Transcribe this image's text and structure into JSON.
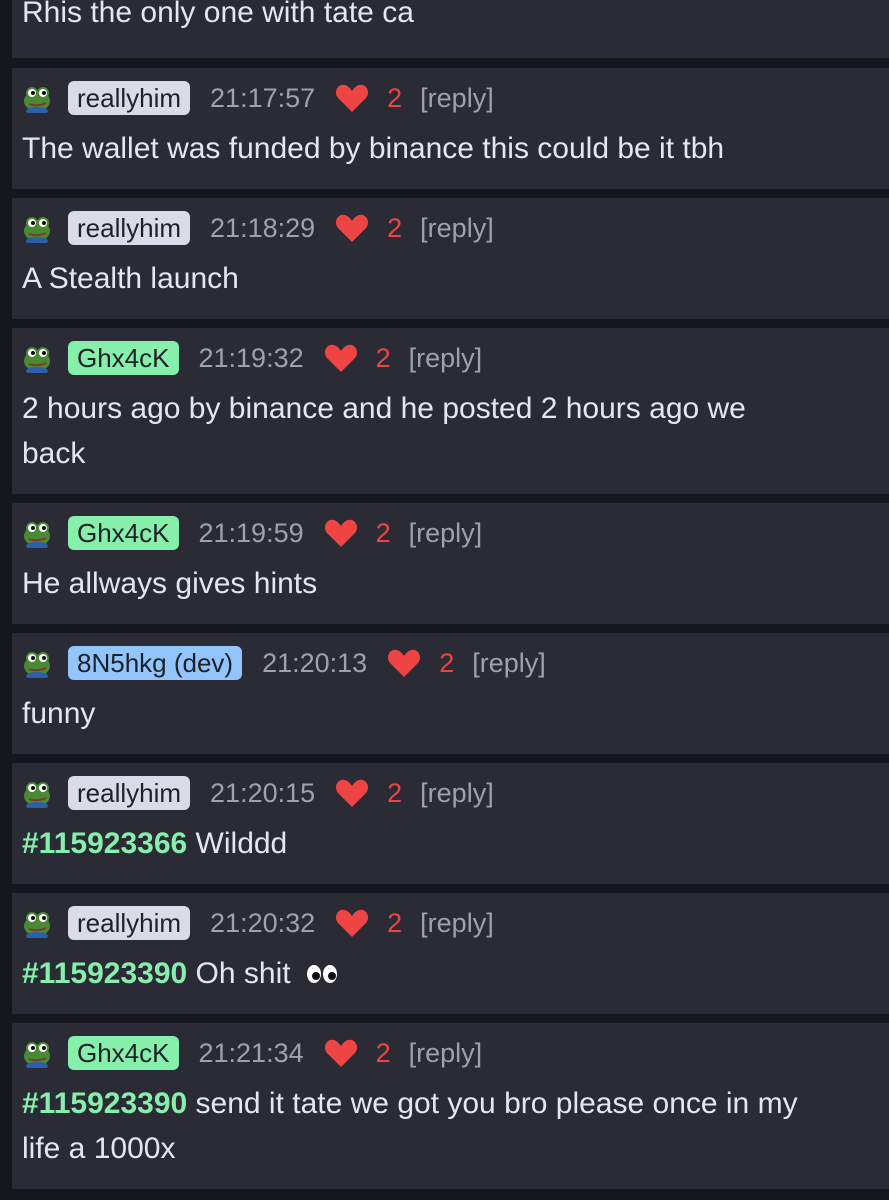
{
  "top_message": {
    "text": "Rhis the only one with tate ca"
  },
  "messages": [
    {
      "user": "reallyhim",
      "time": "21:17:57",
      "likes": "2",
      "reply": "[reply]",
      "text": "The wallet was funded by binance this could be it tbh"
    },
    {
      "user": "reallyhim",
      "time": "21:18:29",
      "likes": "2",
      "reply": "[reply]",
      "text": "A Stealth launch"
    },
    {
      "user": "Ghx4cK",
      "time": "21:19:32",
      "likes": "2",
      "reply": "[reply]",
      "text_line1": "2 hours ago by binance and he posted 2 hours ago we",
      "text_line2": "back"
    },
    {
      "user": "Ghx4cK",
      "time": "21:19:59",
      "likes": "2",
      "reply": "[reply]",
      "text": "He allways gives hints"
    },
    {
      "user": "8N5hkg (dev)",
      "time": "21:20:13",
      "likes": "2",
      "reply": "[reply]",
      "text": "funny"
    },
    {
      "user": "reallyhim",
      "time": "21:20:15",
      "likes": "2",
      "reply": "[reply]",
      "ref": "#115923366",
      "text": "Wilddd"
    },
    {
      "user": "reallyhim",
      "time": "21:20:32",
      "likes": "2",
      "reply": "[reply]",
      "ref": "#115923390",
      "text": "Oh shit",
      "emoji": "eyes-emoji"
    },
    {
      "user": "Ghx4cK",
      "time": "21:21:34",
      "likes": "2",
      "reply": "[reply]",
      "ref": "#115923390",
      "text_line1": "send it tate we got you bro please once in my",
      "text_line2": "life a 1000x"
    }
  ],
  "colors": {
    "background": "#16171c",
    "card": "#2a2b34",
    "tag_grey": "#d9dbe9",
    "tag_green": "#86efac",
    "tag_blue": "#93c5fd",
    "heart": "#ef4444",
    "reference": "#86efac",
    "muted": "#9ca3af"
  },
  "icons": {
    "avatar": "frog-avatar-icon",
    "like": "heart-icon"
  }
}
